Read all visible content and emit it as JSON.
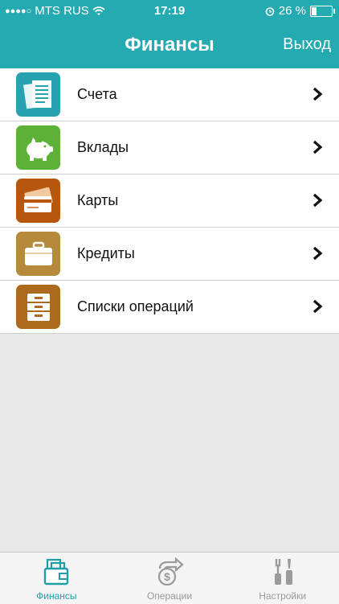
{
  "status": {
    "carrier": "MTS RUS",
    "time": "17:19",
    "battery": "26 %",
    "battery_level": 0.26
  },
  "nav": {
    "title": "Финансы",
    "exit_label": "Выход"
  },
  "menu": [
    {
      "label": "Счета",
      "icon": "accounts-icon",
      "color": "#27a3b0"
    },
    {
      "label": "Вклады",
      "icon": "piggy-bank-icon",
      "color": "#5bb236"
    },
    {
      "label": "Карты",
      "icon": "cards-icon",
      "color": "#b7570e"
    },
    {
      "label": "Кредиты",
      "icon": "briefcase-icon",
      "color": "#b58a3b"
    },
    {
      "label": "Списки операций",
      "icon": "cabinet-icon",
      "color": "#ad6a1c"
    }
  ],
  "tabs": [
    {
      "label": "Финансы",
      "icon": "wallet-icon",
      "active": true
    },
    {
      "label": "Операции",
      "icon": "dollar-arrow-icon",
      "active": false
    },
    {
      "label": "Настройки",
      "icon": "tools-icon",
      "active": false
    }
  ],
  "colors": {
    "header": "#24aab1",
    "active_tab": "#1f9ea5",
    "inactive_tab": "#9a9a9a",
    "background": "#e7e7e7"
  }
}
